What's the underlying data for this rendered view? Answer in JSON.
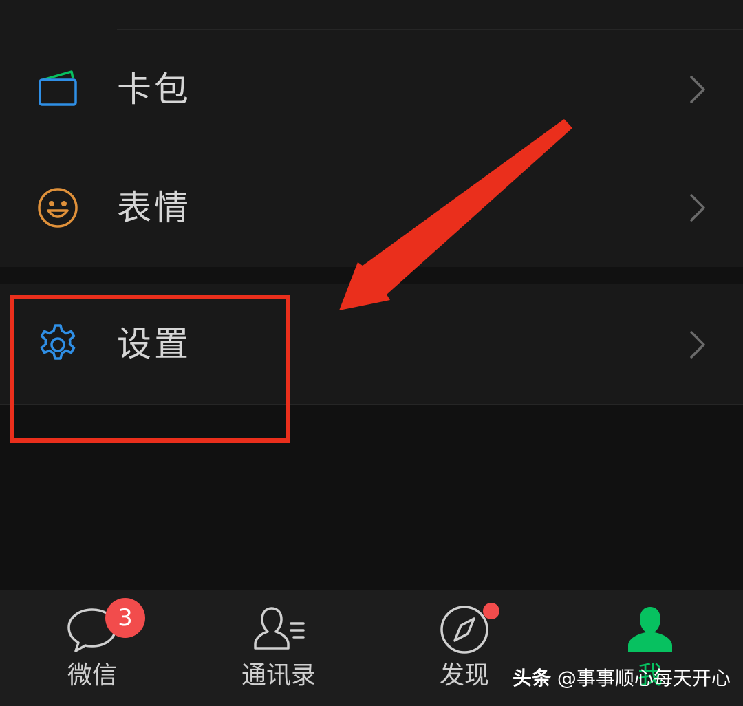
{
  "menu": {
    "items": [
      {
        "label": "卡包",
        "icon": "wallet-icon"
      },
      {
        "label": "表情",
        "icon": "smiley-icon"
      },
      {
        "label": "设置",
        "icon": "gear-icon"
      }
    ]
  },
  "tabbar": {
    "tabs": [
      {
        "label": "微信",
        "icon": "chat-icon",
        "badge": "3"
      },
      {
        "label": "通讯录",
        "icon": "contacts-icon"
      },
      {
        "label": "发现",
        "icon": "compass-icon",
        "dot": true
      },
      {
        "label": "我",
        "icon": "person-icon",
        "active": true
      }
    ]
  },
  "watermark": {
    "brand": "头条",
    "handle": "@事事顺心每天开心"
  },
  "colors": {
    "accent_green": "#07c160",
    "highlight_red": "#ea2f1c",
    "badge_red": "#f24c4c"
  }
}
